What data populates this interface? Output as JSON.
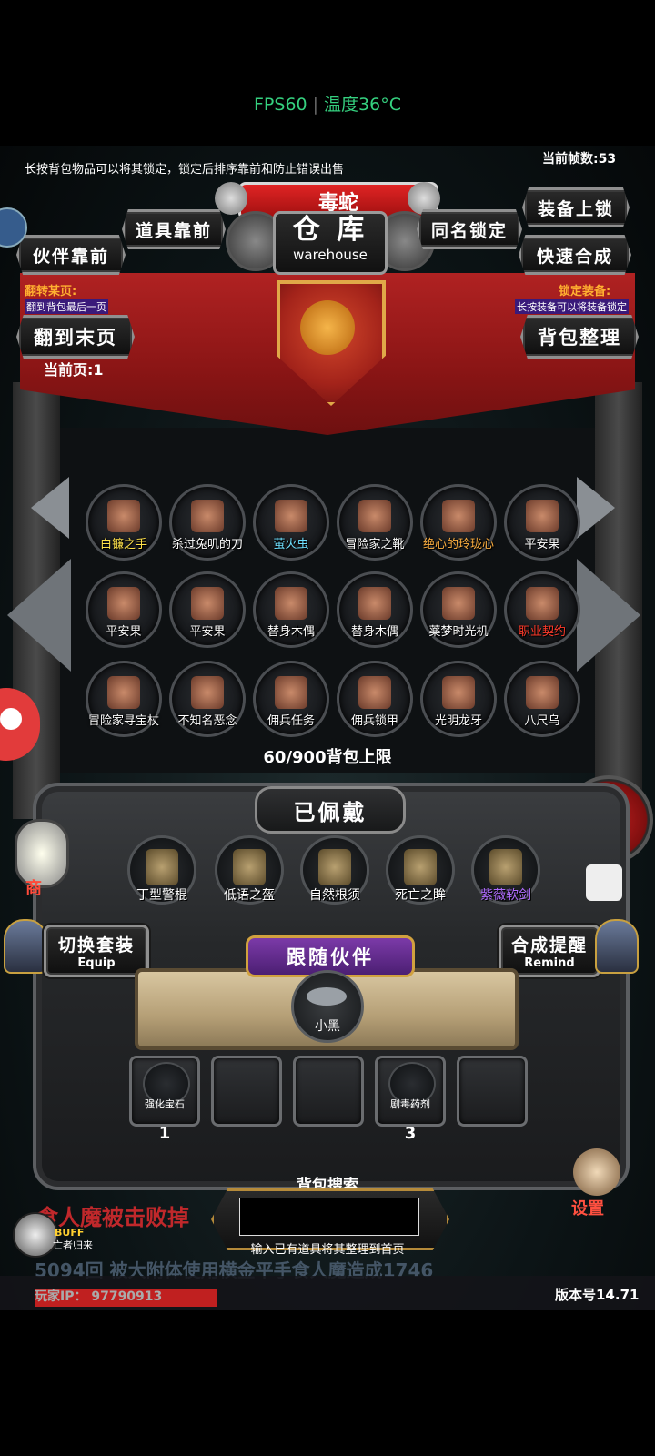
{
  "status": {
    "fps": "FPS60",
    "temp": "温度36°C"
  },
  "colors": {
    "banner_red": "#a31c1c",
    "gold": "#e0a848",
    "accent_green": "#35d07f"
  },
  "header": {
    "lock_tip": "长按背包物品可以将其锁定，锁定后排序靠前和防止错误出售",
    "frame_count": "当前帧数:53",
    "enemy_name": "毒蛇",
    "title_cn": "仓 库",
    "title_en": "warehouse"
  },
  "buttons": {
    "items_front": "道具靠前",
    "partner_front": "伙伴靠前",
    "same_name_lock": "同名锁定",
    "equip_lock": "装备上锁",
    "quick_combine": "快速合成",
    "last_page": "翻到末页",
    "sort_bag": "背包整理",
    "switch_set": "切换套装",
    "switch_set_en": "Equip",
    "combine_remind": "合成提醒",
    "combine_remind_en": "Remind",
    "settings": "设置",
    "shop_partial": "商"
  },
  "flip": {
    "title": "翻转某页:",
    "desc": "翻到背包最后一页",
    "current_page": "当前页:1"
  },
  "lock_equip": {
    "title": "锁定装备:",
    "desc": "长按装备可以将装备锁定"
  },
  "inventory": {
    "items": [
      {
        "name": "白镰之手",
        "icon": "yellow-claw-icon",
        "color": "#ffe14a"
      },
      {
        "name": "杀过兔叽的刀",
        "icon": "knife-icon",
        "color": "#ffffff"
      },
      {
        "name": "萤火虫",
        "icon": "firefly-icon",
        "color": "#6ee0ff"
      },
      {
        "name": "冒险家之靴",
        "icon": "boots-icon",
        "color": "#ffffff"
      },
      {
        "name": "绝心的玲珑心",
        "icon": "red-drop-icon",
        "color": "#ffb040"
      },
      {
        "name": "平安果",
        "icon": "apple-icon",
        "color": "#ffffff"
      },
      {
        "name": "平安果",
        "icon": "apple-icon",
        "color": "#ffffff"
      },
      {
        "name": "平安果",
        "icon": "apple-icon",
        "color": "#ffffff"
      },
      {
        "name": "替身木偶",
        "icon": "wooden-doll-icon",
        "color": "#ffffff"
      },
      {
        "name": "替身木偶",
        "icon": "wooden-doll-icon",
        "color": "#ffffff"
      },
      {
        "name": "薬梦时光机",
        "icon": "time-machine-icon",
        "color": "#ffffff"
      },
      {
        "name": "职业契约",
        "icon": "scroll-icon",
        "color": "#ff3a2a"
      },
      {
        "name": "冒险家寻宝杖",
        "icon": "staff-icon",
        "color": "#ffffff"
      },
      {
        "name": "不知名恶念",
        "icon": "ghost-icon",
        "color": "#ffffff"
      },
      {
        "name": "佣兵任务",
        "icon": "horn-icon",
        "color": "#ffffff"
      },
      {
        "name": "佣兵锁甲",
        "icon": "chainmail-icon",
        "color": "#ffffff"
      },
      {
        "name": "光明龙牙",
        "icon": "fang-icon",
        "color": "#ffffff"
      },
      {
        "name": "八尺乌",
        "icon": "crow-icon",
        "color": "#ffffff"
      }
    ],
    "capacity": "60/900背包上限"
  },
  "equipped": {
    "title": "已佩戴",
    "items": [
      {
        "name": "丁型警棍",
        "icon": "baton-icon",
        "color": "#ffffff"
      },
      {
        "name": "低语之盔",
        "icon": "helmet-icon",
        "color": "#ffffff"
      },
      {
        "name": "自然根须",
        "icon": "green-boots-icon",
        "color": "#ffffff"
      },
      {
        "name": "死亡之眸",
        "icon": "gold-orb-icon",
        "color": "#ffffff"
      },
      {
        "name": "紫薇软剑",
        "icon": "sword-icon",
        "color": "#b06cff"
      }
    ]
  },
  "partner": {
    "title": "跟随伙伴",
    "name": "小黑"
  },
  "consumables": [
    {
      "name": "强化宝石",
      "count": "1",
      "icon": "green-gem-icon"
    },
    {
      "name": "",
      "count": "",
      "icon": ""
    },
    {
      "name": "",
      "count": "",
      "icon": ""
    },
    {
      "name": "剧毒药剂",
      "count": "3",
      "icon": "potion-icon"
    },
    {
      "name": "",
      "count": "",
      "icon": ""
    }
  ],
  "search": {
    "title": "背包搜索",
    "hint": "输入已有道具将其整理到首页",
    "value": ""
  },
  "bottom": {
    "kill_msg": "食人魔被击败掉",
    "buff_label": "BUFF",
    "buff_sub": "亡者归来",
    "scroll_msg": "5094回 被大附体使用横金平手食人魔造成1746",
    "player_ip": "玩家IP：  97790913",
    "version": "版本号14.71"
  }
}
